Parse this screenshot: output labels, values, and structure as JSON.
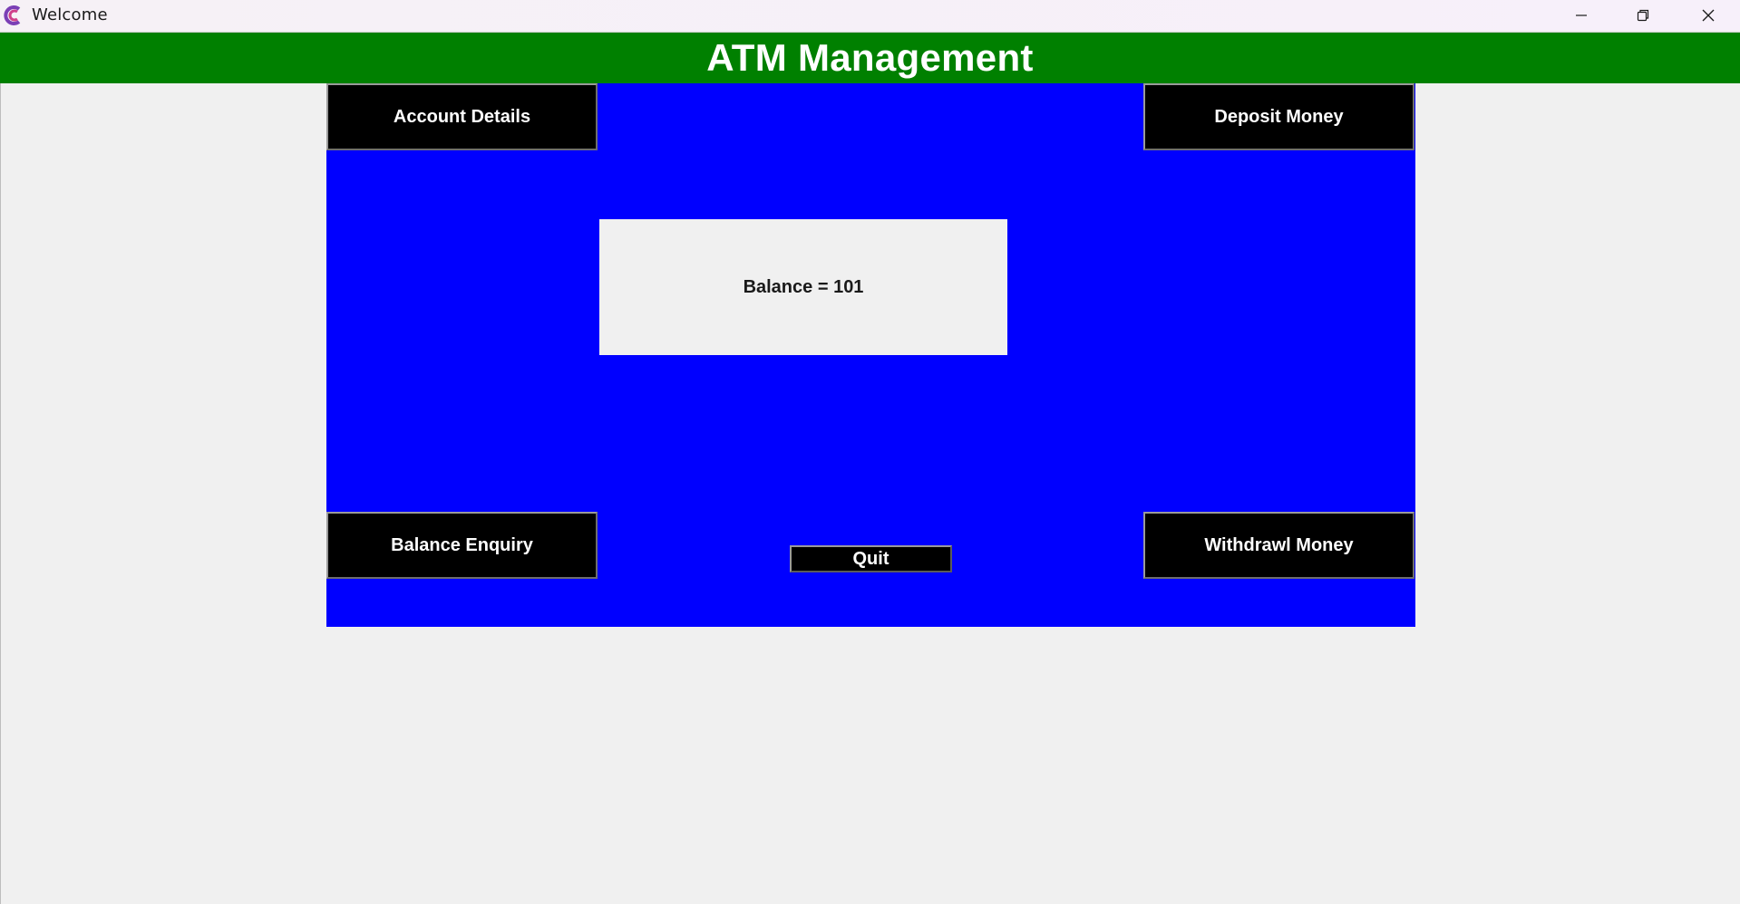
{
  "window": {
    "title": "Welcome",
    "controls": [
      "minimize",
      "restore",
      "close"
    ]
  },
  "header": {
    "title": "ATM Management",
    "background": "#008000"
  },
  "panel": {
    "background": "#0000ff",
    "buttons": {
      "account_details": "Account Details",
      "deposit_money": "Deposit Money",
      "balance_enquiry": "Balance Enquiry",
      "withdrawl_money": "Withdrawl Money",
      "quit": "Quit"
    },
    "balance_display": "Balance = 101"
  },
  "icons": {
    "app": "app-logo-icon",
    "minimize": "minimize-icon",
    "restore": "restore-icon",
    "close": "close-icon"
  }
}
